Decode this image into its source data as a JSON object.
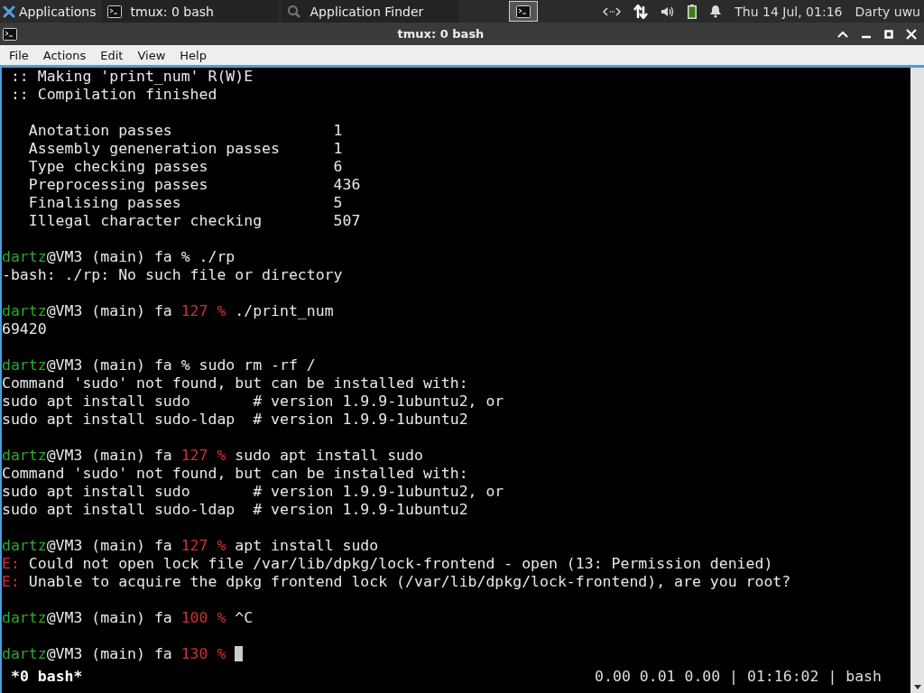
{
  "taskbar": {
    "apps_label": "Applications",
    "tasks": [
      {
        "label": "tmux: 0 bash",
        "kind": "terminal",
        "selected": false
      },
      {
        "label": "Application Finder",
        "kind": "finder",
        "selected": false
      }
    ],
    "clock": "Thu 14 Jul, 01:16",
    "user": "Darty uwu"
  },
  "window": {
    "title": "tmux: 0 bash"
  },
  "menu": [
    "File",
    "Actions",
    "Edit",
    "View",
    "Help"
  ],
  "terminal": {
    "cursor_visible": true,
    "blocks": [
      {
        "lines": [
          [
            {
              "kind": "plain",
              "text": " :: Making 'print_num' R(W)E"
            }
          ],
          [
            {
              "kind": "plain",
              "text": " :: Compilation finished"
            }
          ]
        ]
      },
      {
        "lines": [
          [
            {
              "kind": "plain",
              "text": "   Anotation passes                  1"
            }
          ],
          [
            {
              "kind": "plain",
              "text": "   Assembly geneneration passes      1"
            }
          ],
          [
            {
              "kind": "plain",
              "text": "   Type checking passes              6"
            }
          ],
          [
            {
              "kind": "plain",
              "text": "   Preprocessing passes              436"
            }
          ],
          [
            {
              "kind": "plain",
              "text": "   Finalising passes                 5"
            }
          ],
          [
            {
              "kind": "plain",
              "text": "   Illegal character checking        507"
            }
          ]
        ]
      },
      {
        "lines": [
          [
            {
              "kind": "user",
              "text": "dartz"
            },
            {
              "kind": "plain",
              "text": "@VM3 (main) fa % ./rp"
            }
          ],
          [
            {
              "kind": "plain",
              "text": "-bash: ./rp: No such file or directory"
            }
          ]
        ]
      },
      {
        "lines": [
          [
            {
              "kind": "user",
              "text": "dartz"
            },
            {
              "kind": "plain",
              "text": "@VM3 (main) fa "
            },
            {
              "kind": "code",
              "text": "127 %"
            },
            {
              "kind": "plain",
              "text": " ./print_num"
            }
          ],
          [
            {
              "kind": "plain",
              "text": "69420"
            }
          ]
        ]
      },
      {
        "lines": [
          [
            {
              "kind": "user",
              "text": "dartz"
            },
            {
              "kind": "plain",
              "text": "@VM3 (main) fa % sudo rm -rf /"
            }
          ],
          [
            {
              "kind": "plain",
              "text": "Command 'sudo' not found, but can be installed with:"
            }
          ],
          [
            {
              "kind": "plain",
              "text": "sudo apt install sudo       # version 1.9.9-1ubuntu2, or"
            }
          ],
          [
            {
              "kind": "plain",
              "text": "sudo apt install sudo-ldap  # version 1.9.9-1ubuntu2"
            }
          ]
        ]
      },
      {
        "lines": [
          [
            {
              "kind": "user",
              "text": "dartz"
            },
            {
              "kind": "plain",
              "text": "@VM3 (main) fa "
            },
            {
              "kind": "code",
              "text": "127 %"
            },
            {
              "kind": "plain",
              "text": " sudo apt install sudo"
            }
          ],
          [
            {
              "kind": "plain",
              "text": "Command 'sudo' not found, but can be installed with:"
            }
          ],
          [
            {
              "kind": "plain",
              "text": "sudo apt install sudo       # version 1.9.9-1ubuntu2, or"
            }
          ],
          [
            {
              "kind": "plain",
              "text": "sudo apt install sudo-ldap  # version 1.9.9-1ubuntu2"
            }
          ]
        ]
      },
      {
        "lines": [
          [
            {
              "kind": "user",
              "text": "dartz"
            },
            {
              "kind": "plain",
              "text": "@VM3 (main) fa "
            },
            {
              "kind": "code",
              "text": "127 %"
            },
            {
              "kind": "plain",
              "text": " apt install sudo"
            }
          ],
          [
            {
              "kind": "code",
              "text": "E:"
            },
            {
              "kind": "plain",
              "text": " Could not open lock file /var/lib/dpkg/lock-frontend - open (13: Permission denied)"
            }
          ],
          [
            {
              "kind": "code",
              "text": "E:"
            },
            {
              "kind": "plain",
              "text": " Unable to acquire the dpkg frontend lock (/var/lib/dpkg/lock-frontend), are you root?"
            }
          ]
        ]
      },
      {
        "lines": [
          [
            {
              "kind": "user",
              "text": "dartz"
            },
            {
              "kind": "plain",
              "text": "@VM3 (main) fa "
            },
            {
              "kind": "code",
              "text": "100 %"
            },
            {
              "kind": "plain",
              "text": " ^C"
            }
          ]
        ]
      },
      {
        "lines": [
          [
            {
              "kind": "user",
              "text": "dartz"
            },
            {
              "kind": "plain",
              "text": "@VM3 (main) fa "
            },
            {
              "kind": "code",
              "text": "130 %"
            }
          ]
        ]
      }
    ]
  },
  "tmux_status": {
    "left": "*0 bash*",
    "right": "0.00 0.01 0.00 | 01:16:02 | bash"
  }
}
